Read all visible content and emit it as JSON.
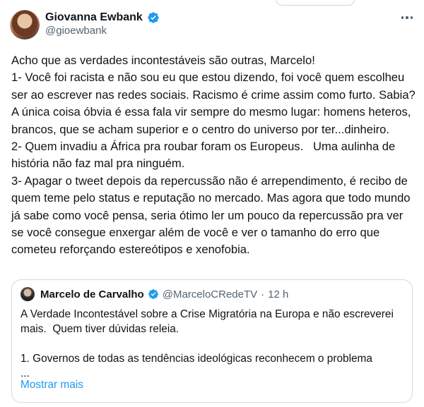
{
  "author": {
    "display_name": "Giovanna Ewbank",
    "handle": "@gioewbank",
    "verified_icon": "verified-badge-icon",
    "avatar": "profile-photo"
  },
  "more_icon": "more-horizontal-icon",
  "tweet": {
    "paragraphs": [
      "Acho que as verdades incontestáveis são outras, Marcelo!",
      "1- Você foi racista e não sou eu que estou dizendo, foi você quem escolheu ser ao escrever nas redes sociais. Racismo é crime assim como furto. Sabia? A única coisa óbvia é essa fala vir sempre do mesmo lugar: homens heteros, brancos, que se acham superior e o centro do universo por ter...dinheiro.",
      "2- Quem invadiu a África pra roubar foram os Europeus.   Uma aulinha de história não faz mal pra ninguém.",
      "3- Apagar o tweet depois da repercussão não é arrependimento, é recibo de quem teme pelo status e reputação no mercado. Mas agora que todo mundo já sabe como você pensa, seria ótimo ler um pouco da repercussão pra ver se você consegue enxergar além de você e ver o tamanho do erro que cometeu reforçando estereótipos e xenofobia."
    ]
  },
  "quoted": {
    "display_name": "Marcelo de Carvalho",
    "handle": "@MarceloCRedeTV",
    "separator": "·",
    "time": "12 h",
    "line1": "A Verdade Incontestável sobre a Crise Migratória na Europa e não escreverei mais.  Quem tiver dúvidas releia.",
    "line2": "1. Governos de todas as tendências ideológicas reconhecem o problema",
    "ellipsis": "...",
    "show_more": "Mostrar mais"
  },
  "colors": {
    "text": "#0f1419",
    "secondary": "#536471",
    "link": "#1d9bf0",
    "verified": "#1d9bf0",
    "border": "#cfd9de"
  }
}
